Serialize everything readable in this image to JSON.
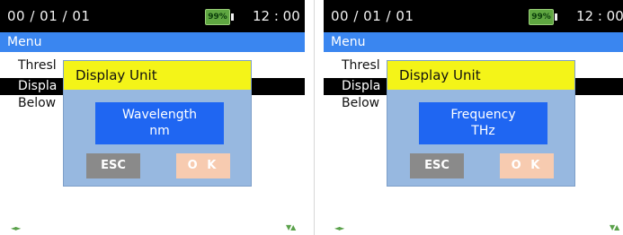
{
  "screens": [
    {
      "status": {
        "date": "00 / 01 / 01",
        "battery": "99%",
        "time": "12 : 00"
      },
      "menu_title": "Menu",
      "menu_items": [
        "Thresl",
        "Displa",
        "Below"
      ],
      "selected_index": 1,
      "dialog": {
        "title": "Display Unit",
        "value_line1": "Wavelength",
        "value_line2": "nm",
        "esc_label": "ESC",
        "ok_label": "O K"
      },
      "nav_glyph": "◄►",
      "scroll_glyph": "▼▲"
    },
    {
      "status": {
        "date": "00 / 01 / 01",
        "battery": "99%",
        "time": "12 : 00"
      },
      "menu_title": "Menu",
      "menu_items": [
        "Thresl",
        "Displa",
        "Below"
      ],
      "selected_index": 1,
      "dialog": {
        "title": "Display Unit",
        "value_line1": "Frequency",
        "value_line2": "THz",
        "esc_label": "ESC",
        "ok_label": "O K"
      },
      "nav_glyph": "◄►",
      "scroll_glyph": "▼▲"
    }
  ],
  "colors": {
    "status_bar": "#000000",
    "menu_bar": "#3a86f0",
    "battery": "#5fa641",
    "dialog_bg": "#97b8e0",
    "dialog_title": "#f4f418",
    "value_box": "#1f66f2",
    "esc_button": "#8a8a8a",
    "ok_button": "#f7cbb0",
    "nav_arrows": "#5aa14a"
  }
}
